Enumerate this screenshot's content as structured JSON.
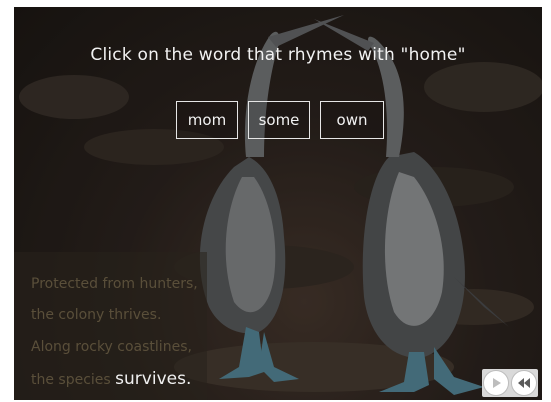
{
  "prompt": "Click on the word that rhymes with \"home\"",
  "choices": [
    "mom",
    "some",
    "own"
  ],
  "poem": {
    "line1": "Protected from hunters,",
    "line2": "the colony thrives.",
    "line3": "Along rocky coastlines,",
    "line4_a": "the species",
    "line4_b": "survives."
  },
  "controls": {
    "play_icon": "play-icon",
    "rewind_icon": "rewind-icon"
  }
}
